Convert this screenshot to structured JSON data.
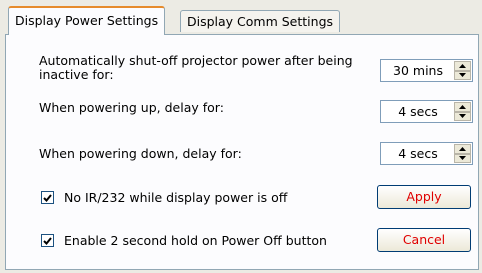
{
  "tabs": [
    {
      "label": "Display Power Settings",
      "active": true
    },
    {
      "label": "Display Comm Settings",
      "active": false
    }
  ],
  "settings": {
    "shutoff": {
      "label_line1": "Automatically shut-off projector power after being",
      "label_line2": "inactive for:",
      "value": "30 mins"
    },
    "power_up": {
      "label": "When powering up, delay for:",
      "value": "4 secs"
    },
    "power_down": {
      "label": "When powering down, delay for:",
      "value": "4 secs"
    }
  },
  "checkboxes": [
    {
      "label": "No IR/232 while display power is off",
      "checked": true
    },
    {
      "label": "Enable 2 second hold on Power Off button",
      "checked": true
    }
  ],
  "buttons": {
    "apply": "Apply",
    "cancel": "Cancel"
  },
  "colors": {
    "button_text": "#e00000",
    "tab_accent": "#e68b2c"
  },
  "icons": {
    "spin_up": "triangle-up-icon",
    "spin_down": "triangle-down-icon",
    "check": "checkmark-icon"
  }
}
